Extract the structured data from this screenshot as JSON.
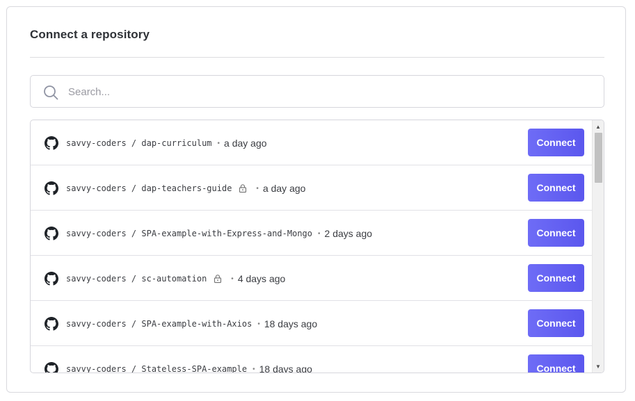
{
  "panel": {
    "title": "Connect a repository"
  },
  "search": {
    "placeholder": "Search..."
  },
  "repos": [
    {
      "name": "savvy-coders / dap-curriculum",
      "private": false,
      "updated": "a day ago",
      "action": "Connect"
    },
    {
      "name": "savvy-coders / dap-teachers-guide",
      "private": true,
      "updated": "a day ago",
      "action": "Connect"
    },
    {
      "name": "savvy-coders / SPA-example-with-Express-and-Mongo",
      "private": false,
      "updated": "2 days ago",
      "action": "Connect"
    },
    {
      "name": "savvy-coders / sc-automation",
      "private": true,
      "updated": "4 days ago",
      "action": "Connect"
    },
    {
      "name": "savvy-coders / SPA-example-with-Axios",
      "private": false,
      "updated": "18 days ago",
      "action": "Connect"
    },
    {
      "name": "savvy-coders / Stateless-SPA-example",
      "private": false,
      "updated": "18 days ago",
      "action": "Connect"
    }
  ],
  "icons": {
    "search": "search-icon",
    "repo": "github-icon",
    "private": "lock-icon",
    "separator": "•"
  },
  "colors": {
    "accent": "#6461f3",
    "text": "#2f3237",
    "border": "#d6d6dc"
  }
}
